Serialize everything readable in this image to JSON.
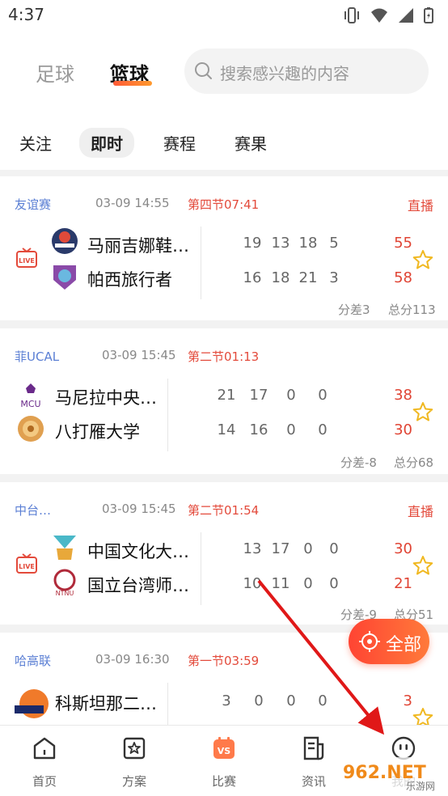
{
  "status": {
    "time": "4:37"
  },
  "header": {
    "sport_tabs": [
      {
        "label": "足球",
        "active": false
      },
      {
        "label": "篮球",
        "active": true
      }
    ],
    "search_placeholder": "搜索感兴趣的内容"
  },
  "subtabs": [
    {
      "label": "关注",
      "active": false
    },
    {
      "label": "即时",
      "active": true
    },
    {
      "label": "赛程",
      "active": false
    },
    {
      "label": "赛果",
      "active": false
    }
  ],
  "matches": [
    {
      "league": "友谊赛",
      "datetime": "03-09 14:55",
      "period": "第四节07:41",
      "live": "直播",
      "home": {
        "name": "马丽吉娜鞋…",
        "quarters": [
          "19",
          "13",
          "18",
          "5"
        ],
        "total": "55"
      },
      "away": {
        "name": "帕西旅行者",
        "quarters": [
          "16",
          "18",
          "21",
          "3"
        ],
        "total": "58"
      },
      "diff": "分差3",
      "sum": "总分113"
    },
    {
      "league": "菲UCAL",
      "datetime": "03-09 15:45",
      "period": "第二节01:13",
      "live": "",
      "home": {
        "name": "马尼拉中央…",
        "quarters": [
          "21",
          "17",
          "0",
          "0"
        ],
        "total": "38",
        "logo_text": "MCU"
      },
      "away": {
        "name": "八打雁大学",
        "quarters": [
          "14",
          "16",
          "0",
          "0"
        ],
        "total": "30"
      },
      "diff": "分差-8",
      "sum": "总分68"
    },
    {
      "league": "中台…",
      "datetime": "03-09 15:45",
      "period": "第二节01:54",
      "live": "直播",
      "home": {
        "name": "中国文化大…",
        "quarters": [
          "13",
          "17",
          "0",
          "0"
        ],
        "total": "30"
      },
      "away": {
        "name": "国立台湾师…",
        "quarters": [
          "10",
          "11",
          "0",
          "0"
        ],
        "total": "21",
        "logo_text": "NTNU"
      },
      "diff": "分差-9",
      "sum": "总分51"
    },
    {
      "league": "哈高联",
      "datetime": "03-09 16:30",
      "period": "第一节03:59",
      "live": "",
      "home": {
        "name": "科斯坦那二…",
        "quarters": [
          "3",
          "0",
          "0",
          "0"
        ],
        "total": "3"
      }
    }
  ],
  "fab": {
    "label": "全部"
  },
  "bottom_nav": [
    {
      "label": "首页",
      "icon": "home-icon"
    },
    {
      "label": "方案",
      "icon": "plan-star-icon"
    },
    {
      "label": "比赛",
      "icon": "vs-icon",
      "active": true
    },
    {
      "label": "资讯",
      "icon": "news-icon"
    },
    {
      "label": "我的",
      "icon": "profile-face-icon"
    }
  ],
  "live_badge_text": "LIVE",
  "vs_text": "VS",
  "watermark": {
    "text": "962.NET",
    "sub": "乐游网"
  },
  "colors": {
    "accent": "#e34a3b",
    "league": "#5b7fd4",
    "fab": "#ff4d36"
  }
}
